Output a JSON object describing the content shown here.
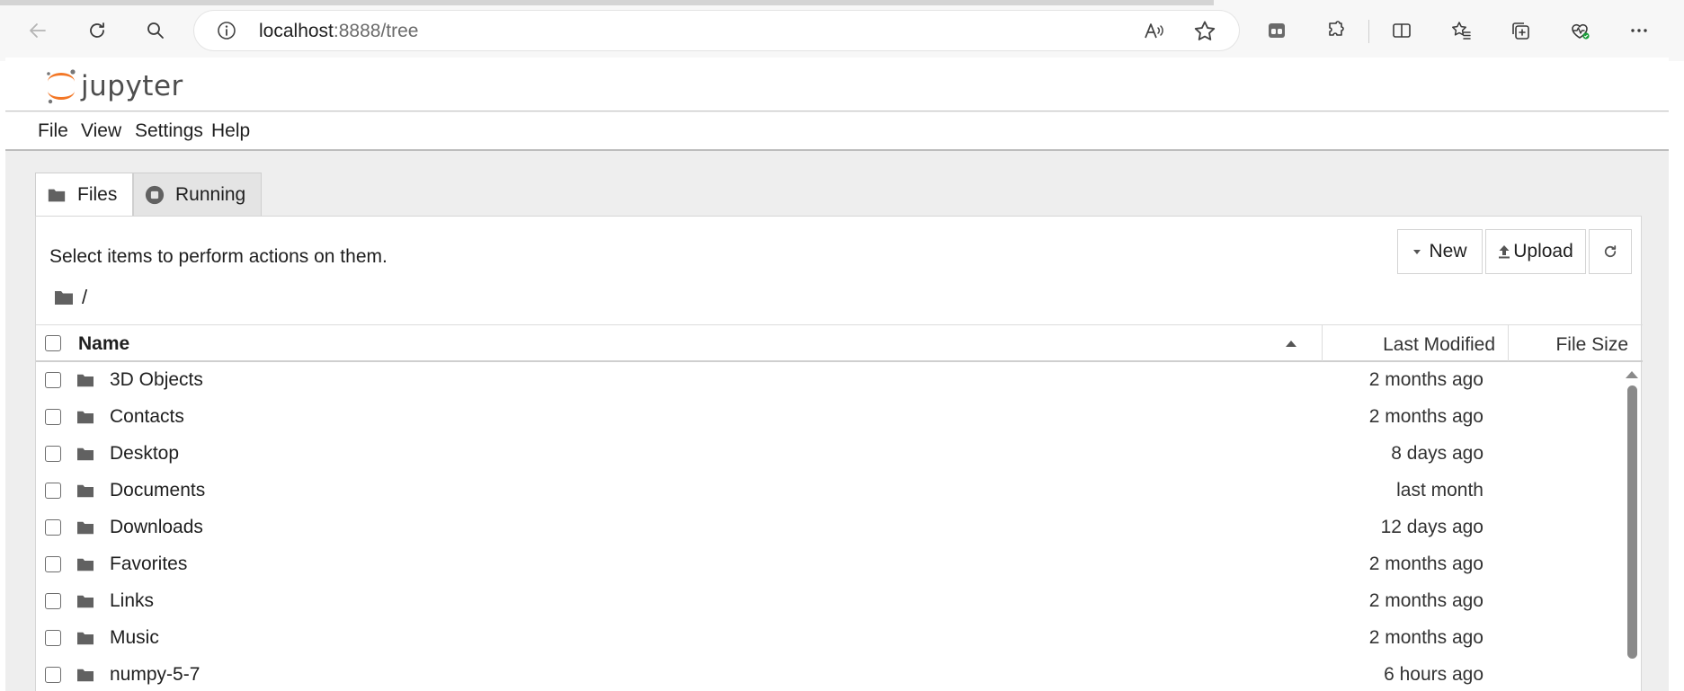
{
  "browser": {
    "url_host": "localhost",
    "url_rest": ":8888/tree",
    "icons": [
      "back-icon",
      "reload-icon",
      "search-icon",
      "info-icon",
      "read-aloud-icon",
      "favorite-star-icon",
      "workspaces-icon",
      "extensions-icon",
      "split-screen-icon",
      "favorites-icon",
      "collections-icon",
      "browser-essentials-icon",
      "more-icon"
    ]
  },
  "header": {
    "logo_text": "jupyter",
    "colors": {
      "logo_orange": "#f37726",
      "logo_gray": "#767677"
    }
  },
  "menubar": {
    "items": [
      "File",
      "View",
      "Settings",
      "Help"
    ]
  },
  "tabs": [
    {
      "label": "Files",
      "icon": "folder-icon",
      "active": true
    },
    {
      "label": "Running",
      "icon": "stop-circle-icon",
      "active": false
    }
  ],
  "toolbar": {
    "hint": "Select items to perform actions on them.",
    "new_label": "New",
    "upload_label": "Upload",
    "refresh_icon": "refresh-icon"
  },
  "breadcrumb": {
    "path": "/"
  },
  "columns": {
    "name": "Name",
    "modified": "Last Modified",
    "size": "File Size",
    "sort": "ascending"
  },
  "files": [
    {
      "name": "3D Objects",
      "modified": "2 months ago",
      "type": "folder"
    },
    {
      "name": "Contacts",
      "modified": "2 months ago",
      "type": "folder"
    },
    {
      "name": "Desktop",
      "modified": "8 days ago",
      "type": "folder"
    },
    {
      "name": "Documents",
      "modified": "last month",
      "type": "folder"
    },
    {
      "name": "Downloads",
      "modified": "12 days ago",
      "type": "folder"
    },
    {
      "name": "Favorites",
      "modified": "2 months ago",
      "type": "folder"
    },
    {
      "name": "Links",
      "modified": "2 months ago",
      "type": "folder"
    },
    {
      "name": "Music",
      "modified": "2 months ago",
      "type": "folder"
    },
    {
      "name": "numpy-5-7",
      "modified": "6 hours ago",
      "type": "folder"
    }
  ]
}
